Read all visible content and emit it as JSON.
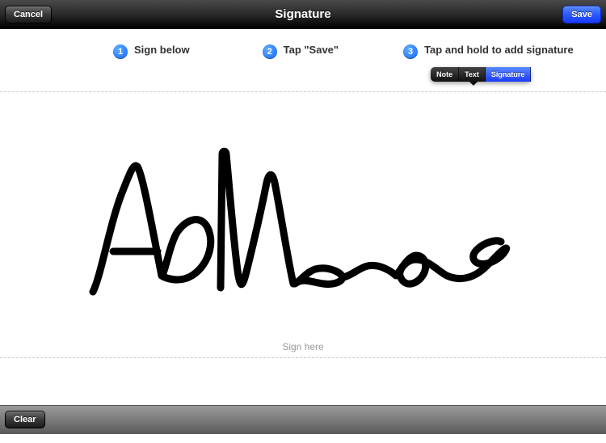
{
  "header": {
    "title": "Signature",
    "cancel_label": "Cancel",
    "save_label": "Save"
  },
  "steps": {
    "s1": {
      "num": "1",
      "text": "Sign below"
    },
    "s2": {
      "num": "2",
      "text": "Tap \"Save\""
    },
    "s3": {
      "num": "3",
      "text": "Tap and hold to add signature"
    }
  },
  "popover": {
    "note": "Note",
    "text": "Text",
    "signature": "Signature"
  },
  "sign_area": {
    "placeholder": "Sign here"
  },
  "footer": {
    "clear_label": "Clear"
  }
}
